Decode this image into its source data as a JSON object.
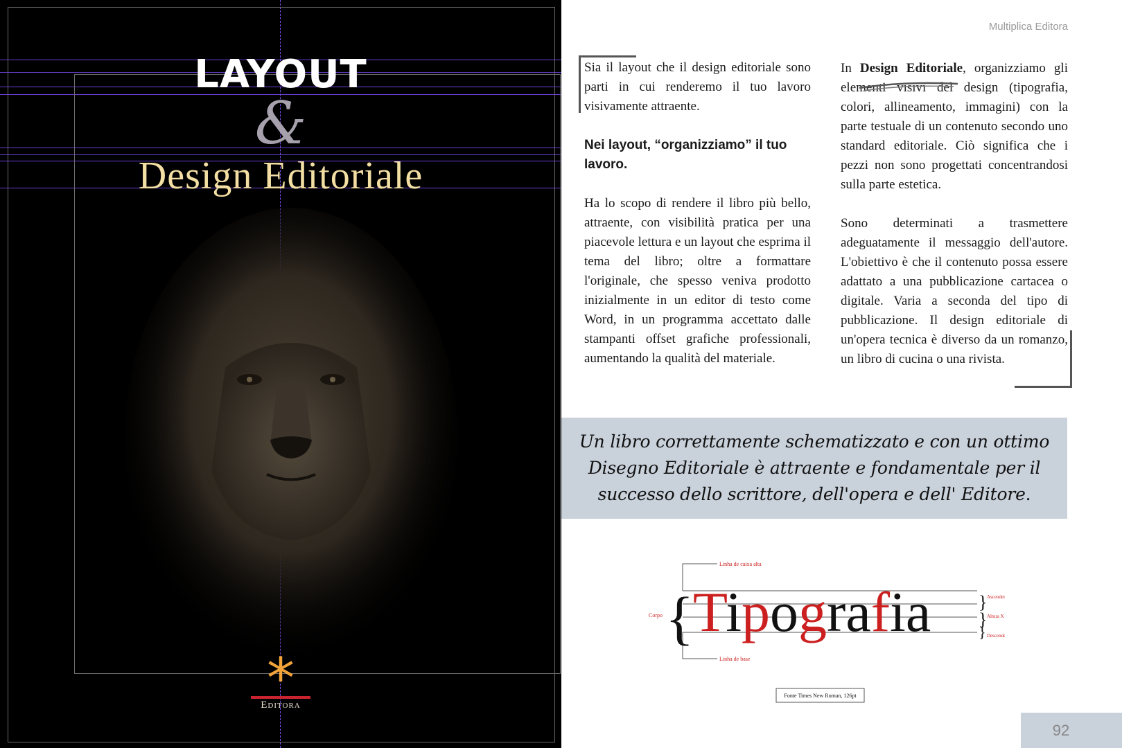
{
  "cover": {
    "title": "LAYOUT",
    "ampersand": "&",
    "subtitle": "Design Editoriale",
    "logo_symbol": "*",
    "logo_text": "Editora",
    "colors": {
      "background": "#000000",
      "title": "#ffffff",
      "ampersand": "#a7a1ae",
      "subtitle": "#f3dfa3",
      "asterisk": "#f2a33a",
      "logo_bar": "#c8232f",
      "guides": "#6a3fd6"
    },
    "image": "lion-face-illustration"
  },
  "header": {
    "publisher": "Multiplica Editora"
  },
  "left_column": {
    "p1": "Sia il layout che il design editoriale sono parti in cui renderemo il tuo lavoro visivamente attraente.",
    "p2": "Nei layout, “organizziamo” il tuo lavoro.",
    "p3": "Ha lo scopo di rendere il libro più bello, attraente, con visibilità pratica per una piacevole lettura e un layout che esprima il tema del libro; oltre a formattare l'originale, che spesso veniva prodotto inizialmente in un editor di testo come Word, in un programma accettato dalle stampanti offset grafiche professionali, aumentando la qualità del materiale."
  },
  "right_column": {
    "p1_start": "In ",
    "p1_bold": "Design Editoriale",
    "p1_rest": ", organizziamo gli elementi visivi del design (tipografia, colori, allineamento, immagini) con la parte testuale di un contenuto secondo uno standard editoriale. Ciò significa che i pezzi non sono progettati concentrandosi sulla parte estetica.",
    "p2": "Sono determinati a trasmettere adeguatamente il messaggio dell'autore. L'obiettivo è che il contenuto possa essere adattato a una pubblicazione cartacea o digitale. Varia a seconda del tipo di pubblicazione. Il design editoriale di un'opera tecnica è diverso da un romanzo, un libro di cucina o una rivista."
  },
  "quote": {
    "text": "Un libro correttamente schematizzato e con un ottimo Disegno Editoriale è attraente e fondamentale per il successo dello scrittore, dell'opera e dell' Editore.",
    "background": "#c9d1db"
  },
  "typography_figure": {
    "word": "Tipografia",
    "label_cap_line": "Linha de caixa alta",
    "label_base_line": "Linha de base",
    "label_body": "Corpo",
    "label_ascenders": "Ascendentes",
    "label_x_height": "Altura X",
    "label_descenders": "Descendentes",
    "caption": "Fonte Times New Roman, 126pt",
    "accent_color": "#cc1f1f"
  },
  "footer": {
    "page_number": "92"
  }
}
